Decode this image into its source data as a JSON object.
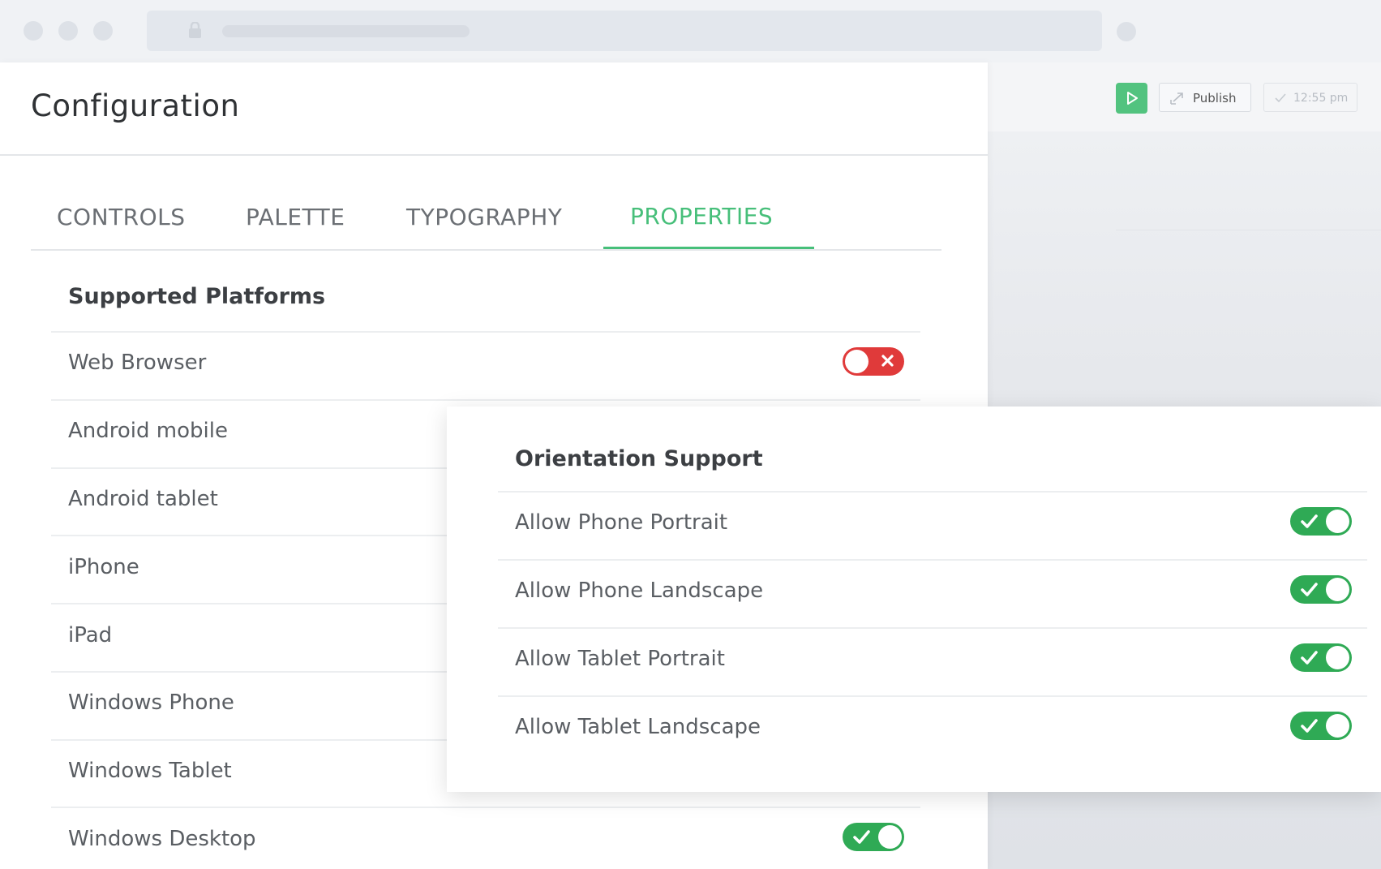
{
  "app_toolbar": {
    "publish_label": "Publish",
    "saved_time": "12:55 pm"
  },
  "config": {
    "title": "Configuration",
    "tabs": [
      {
        "label": "CONTROLS",
        "active": false
      },
      {
        "label": "PALETTE",
        "active": false
      },
      {
        "label": "TYPOGRAPHY",
        "active": false
      },
      {
        "label": "PROPERTIES",
        "active": true
      }
    ]
  },
  "platforms": {
    "title": "Supported Platforms",
    "items": [
      {
        "label": "Web Browser",
        "enabled": false
      },
      {
        "label": "Android mobile"
      },
      {
        "label": "Android tablet"
      },
      {
        "label": "iPhone"
      },
      {
        "label": "iPad"
      },
      {
        "label": "Windows Phone"
      },
      {
        "label": "Windows Tablet"
      },
      {
        "label": "Windows Desktop",
        "enabled": true
      }
    ]
  },
  "orientation": {
    "title": "Orientation Support",
    "items": [
      {
        "label": "Allow Phone Portrait",
        "enabled": true
      },
      {
        "label": "Allow Phone Landscape",
        "enabled": true
      },
      {
        "label": "Allow Tablet Portrait",
        "enabled": true
      },
      {
        "label": "Allow Tablet Landscape",
        "enabled": true
      }
    ]
  },
  "colors": {
    "accent_green": "#47bf7a",
    "toggle_on": "#2faa55",
    "toggle_off": "#e03a3a"
  },
  "icons": [
    "lock-icon",
    "play-icon",
    "publish-icon",
    "check-icon",
    "close-icon"
  ]
}
